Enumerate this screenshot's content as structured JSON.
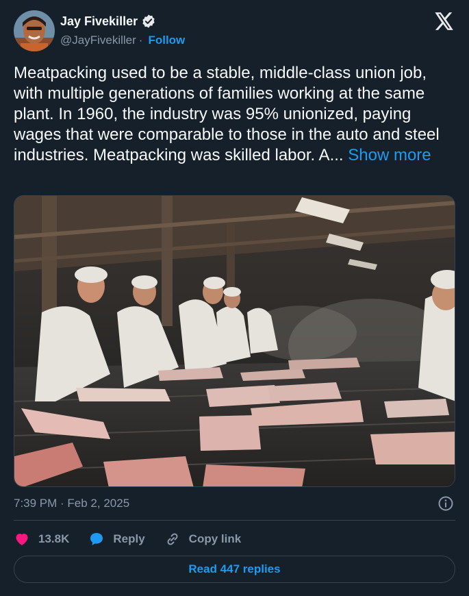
{
  "author": {
    "name": "Jay Fivekiller",
    "handle": "@JayFivekiller",
    "separator": "·",
    "follow_label": "Follow"
  },
  "tweet": {
    "text": "Meatpacking used to be a stable, middle-class union job, with multiple generations of families working at the same plant. In 1960, the industry was 95% unionized, paying wages that were comparable to those in the auto and steel industries. Meatpacking was skilled labor.  A... ",
    "show_more": "Show more",
    "timestamp": "7:39 PM · Feb 2, 2025"
  },
  "actions": {
    "like_count": "13.8K",
    "reply_label": "Reply",
    "copy_link_label": "Copy link"
  },
  "read_replies_label": "Read 447 replies",
  "colors": {
    "background": "#15202b",
    "accent": "#1d9bf0",
    "like": "#f91880",
    "muted": "#8b98a5",
    "border": "#38444d"
  },
  "icons": [
    "x-logo-icon",
    "verified-badge-icon",
    "info-icon",
    "heart-icon",
    "reply-bubble-icon",
    "link-icon"
  ]
}
